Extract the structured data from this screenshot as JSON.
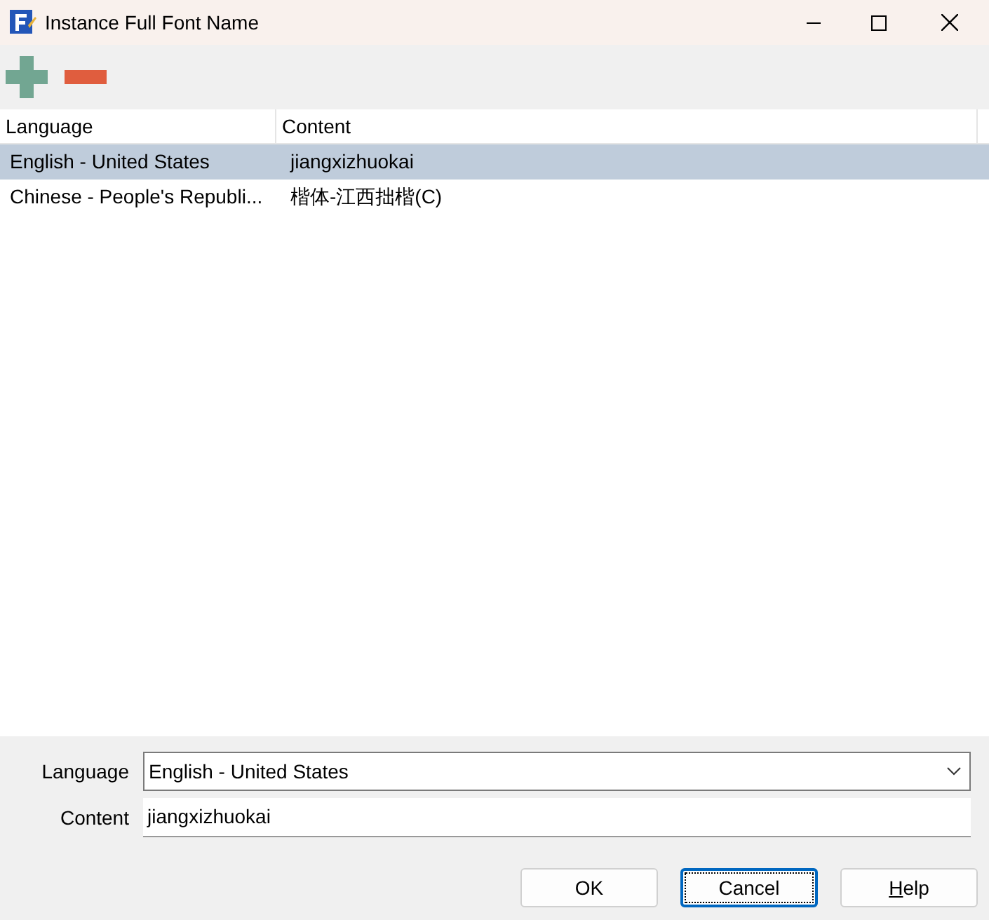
{
  "window": {
    "title": "Instance Full Font Name"
  },
  "toolbar": [
    {
      "kind": "add"
    },
    {
      "kind": "remove"
    }
  ],
  "table": {
    "columns": [
      "Language",
      "Content"
    ],
    "rows": [
      {
        "selected": true,
        "cells": [
          "English - United States",
          "jiangxizhuokai"
        ]
      },
      {
        "selected": false,
        "cells": [
          "Chinese - People's Republi...",
          "楷体-江西拙楷(C)"
        ]
      }
    ]
  },
  "form": {
    "language": {
      "label": "Language",
      "value": "English - United States"
    },
    "content": {
      "label": "Content",
      "value": "jiangxizhuokai"
    }
  },
  "buttons": [
    {
      "label": "OK",
      "focused": false,
      "underline_first": false
    },
    {
      "label": "Cancel",
      "focused": true,
      "underline_first": false
    },
    {
      "label": "Help",
      "focused": false,
      "underline_first": true
    }
  ]
}
